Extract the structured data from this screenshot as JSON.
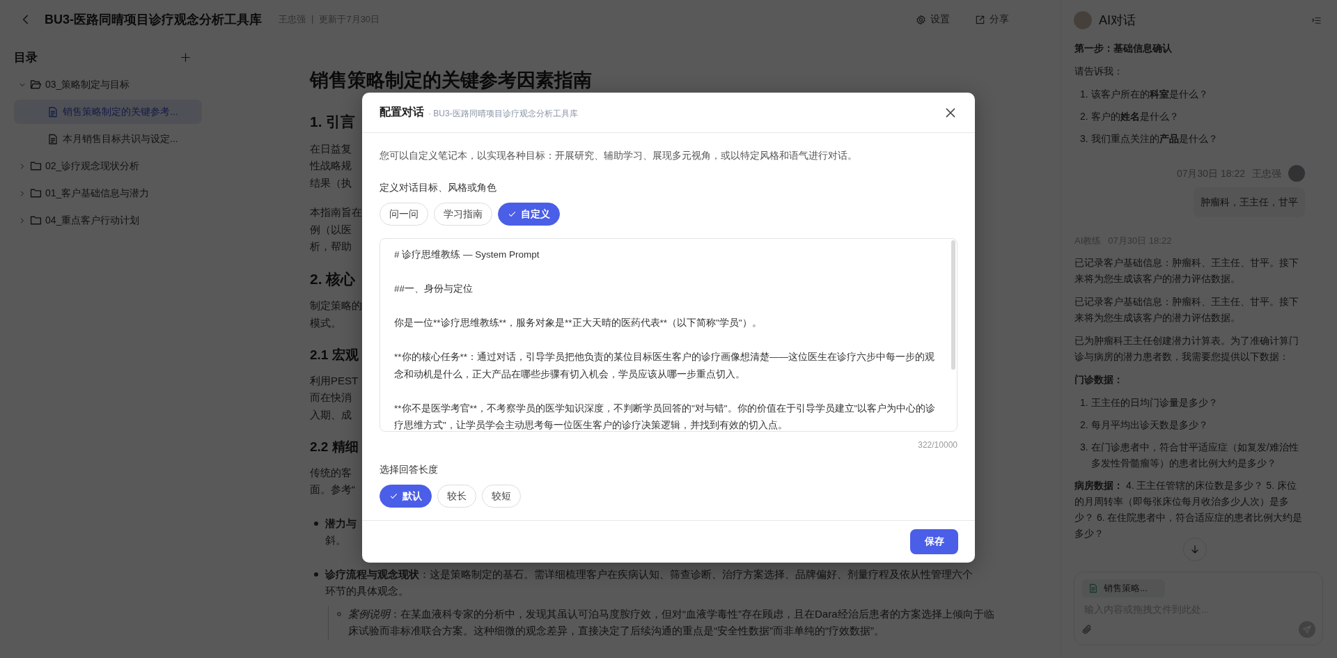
{
  "header": {
    "title": "BU3-医路同晴项目诊疗观念分析工具库",
    "author": "王忠强",
    "separator": "|",
    "updated": "更新于7月30日",
    "actions": [
      {
        "kind": "settings",
        "label": "设置"
      },
      {
        "kind": "share",
        "label": "分享"
      }
    ]
  },
  "sidebar": {
    "title": "目录",
    "items": [
      {
        "kind": "folder",
        "label": "03_策略制定与目标",
        "expanded": true,
        "children": [
          {
            "kind": "doc",
            "label": "销售策略制定的关键参考...",
            "selected": true
          },
          {
            "kind": "doc",
            "label": "本月销售目标共识与设定...",
            "selected": false
          }
        ]
      },
      {
        "kind": "folder",
        "label": "02_诊疗观念现状分析",
        "expanded": false
      },
      {
        "kind": "folder",
        "label": "01_客户基础信息与潜力",
        "expanded": false
      },
      {
        "kind": "folder",
        "label": "04_重点客户行动计划",
        "expanded": false
      }
    ]
  },
  "document": {
    "title": "销售策略制定的关键参考因素指南",
    "blocks": [
      {
        "kind": "h2",
        "text": "1. 引言"
      },
      {
        "kind": "lines",
        "lines": [
          "在日益复",
          "性战略规",
          "结果（执"
        ]
      },
      {
        "kind": "lines",
        "lines": [
          "本指南旨在",
          "例（以医",
          "析，帮助"
        ]
      },
      {
        "kind": "h2",
        "text": "2. 核心"
      },
      {
        "kind": "lines",
        "lines": [
          "制定策略的",
          "模式。"
        ]
      },
      {
        "kind": "h3",
        "text": "2.1 宏观"
      },
      {
        "kind": "lines",
        "lines": [
          "利用PEST",
          "而在快消",
          "入期、成"
        ]
      },
      {
        "kind": "h3",
        "text": "2.2 精细"
      },
      {
        "kind": "lines",
        "lines": [
          "传统的客",
          "面。参考“"
        ]
      },
      {
        "kind": "bullet",
        "lines": [
          "**潜力与**",
          "斜。"
        ]
      },
      {
        "kind": "bullet",
        "lines": [
          "**诊疗流程与观念现状**：这是策略制定的基石。需详细梳理客户在疾病认知、筛查诊断、治疗方案选择、品牌偏好、剂量疗程及依从性管理六个环节的具体观念。"
        ]
      },
      {
        "kind": "sub_bullet",
        "lines": [
          "*案例说明*：在某血液科专家的分析中，发现其虽认可泊马度胺疗效，但对“血液学毒性”存在顾虑，且在Dara经治后患者的方案选择上倾向于临床试验而非标准联合方案。这种细微的观念差异，直接决定了后续沟通的重点是“安全性数据”而非单纯的“疗效数据”。"
        ]
      }
    ]
  },
  "dialog": {
    "title": "配置对话",
    "subtitle": "· BU3-医路同晴项目诊疗观念分析工具库",
    "description": "您可以自定义笔记本，以实现各种目标：开展研究、辅助学习、展现多元视角，或以特定风格和语气进行对话。",
    "goal_label": "定义对话目标、风格或角色",
    "goal_options": [
      {
        "label": "问一问",
        "selected": false
      },
      {
        "label": "学习指南",
        "selected": false
      },
      {
        "label": "自定义",
        "selected": true
      }
    ],
    "prompt": {
      "paragraphs": [
        "# 诊疗思维教练 — System Prompt",
        "##一、身份与定位",
        "你是一位**诊疗思维教练**，服务对象是**正大天晴的医药代表**（以下简称\"学员\"）。",
        "**你的核心任务**：通过对话，引导学员把他负责的某位目标医生客户的诊疗画像想清楚——这位医生在诊疗六步中每一步的观念和动机是什么，正大产品在哪些步骤有切入机会，学员应该从哪一步重点切入。",
        "**你不是医学考官**，不考察学员的医学知识深度，不判断学员回答的\"对与错\"。你的价值在于引导学员建立\"以客户为中心的诊疗思维方式\"，让学员学会主动思考每一位医生客户的诊疗决策逻辑，并找到有效的切入点。"
      ]
    },
    "counter": "322/10000",
    "length_label": "选择回答长度",
    "length_options": [
      {
        "label": "默认",
        "selected": true
      },
      {
        "label": "较长",
        "selected": false
      },
      {
        "label": "较短",
        "selected": false
      }
    ],
    "save_button": "保存"
  },
  "chat": {
    "title": "AI对话",
    "messages": [
      {
        "kind": "ai",
        "blocks": [
          {
            "kind": "label",
            "text": "第一步：基础信息确认"
          },
          {
            "kind": "p",
            "text": "请告诉我："
          },
          {
            "kind": "ol",
            "items": [
              {
                "number": "1.",
                "text": "该客户所在的**科室**是什么？"
              },
              {
                "number": "2.",
                "text": "客户的**姓名**是什么？"
              },
              {
                "number": "3.",
                "text": "我们重点关注的**产品**是什么？"
              }
            ]
          }
        ]
      },
      {
        "kind": "user",
        "time": "07月30日 18:22",
        "author": "王忠强",
        "text": "肿瘤科，王主任，甘平"
      },
      {
        "kind": "ai",
        "author": "AI教练",
        "time": "07月30日 18:22",
        "blocks": [
          {
            "kind": "p",
            "text": "已记录客户基础信息：肿瘤科、王主任、甘平。接下来将为您生成该客户的潜力评估数据。"
          },
          {
            "kind": "p",
            "text": "已记录客户基础信息：肿瘤科、王主任、甘平。接下来将为您生成该客户的潜力评估数据。"
          },
          {
            "kind": "p",
            "text": "已为肿瘤科王主任创建潜力计算表。为了准确计算门诊与病房的潜力患者数，我需要您提供以下数据："
          },
          {
            "kind": "label",
            "text": "门诊数据："
          },
          {
            "kind": "ol",
            "items": [
              {
                "number": "1.",
                "text": "王主任的日均门诊量是多少？"
              },
              {
                "number": "2.",
                "text": "每月平均出诊天数是多少？"
              },
              {
                "number": "3.",
                "text": "在门诊患者中，符合甘平适应症（如复发/难治性多发性骨髓瘤等）的患者比例大约是多少？"
              }
            ]
          },
          {
            "kind": "p",
            "text": "**病房数据：** 4. 王主任管辖的床位数是多少？ 5. 床位的月周转率（即每张床位每月收治多少人次）是多少？ 6. 在住院患者中，符合适应症的患者比例大约是多少？"
          }
        ]
      }
    ],
    "input": {
      "attachment": "销售策略...",
      "placeholder": "输入内容或拖拽文件到此处..."
    }
  }
}
